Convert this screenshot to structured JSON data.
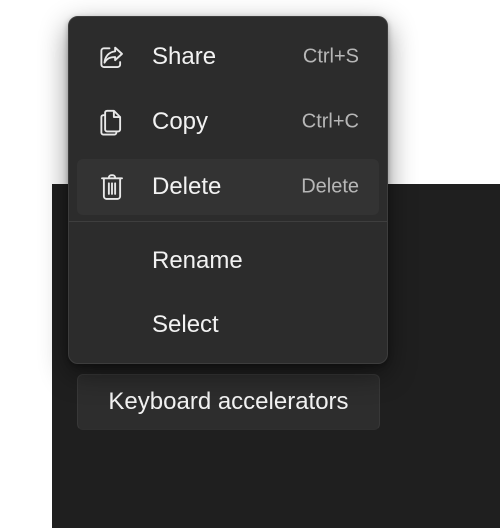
{
  "context_menu": {
    "items": [
      {
        "label": "Share",
        "shortcut": "Ctrl+S",
        "icon": "share-icon"
      },
      {
        "label": "Copy",
        "shortcut": "Ctrl+C",
        "icon": "copy-icon"
      },
      {
        "label": "Delete",
        "shortcut": "Delete",
        "icon": "delete-icon"
      },
      {
        "label": "Rename"
      },
      {
        "label": "Select"
      }
    ]
  },
  "button": {
    "label": "Keyboard accelerators"
  },
  "colors": {
    "menu_background": "#2c2c2c",
    "hover_background": "#333333",
    "dark_area": "#1f1f1f",
    "page_background": "#ffffff",
    "text": "#f2f2f2",
    "shortcut_text": "#b7b7b7"
  }
}
